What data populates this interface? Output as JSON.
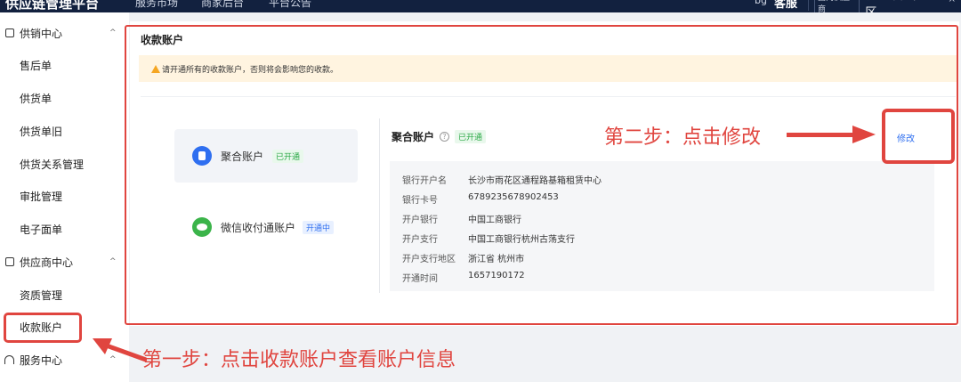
{
  "topbar": {
    "brand": "供应链管理平台",
    "nav": [
      "服务市场",
      "商家后台",
      "平台公告"
    ],
    "cs_icon": "bg",
    "customer_service": "客服",
    "region_tag": "国内供应商",
    "region": "长沙市雨花区...",
    "region_chevron": "^"
  },
  "sidebar": {
    "group1": {
      "label": "供销中心",
      "chevron": "^"
    },
    "items1": [
      "售后单",
      "供货单",
      "供货单旧",
      "供货关系管理",
      "审批管理",
      "电子面单"
    ],
    "group2": {
      "label": "供应商中心",
      "chevron": "^"
    },
    "items2": [
      "资质管理",
      "收款账户"
    ],
    "group3": {
      "label": "服务中心",
      "chevron": "^"
    }
  },
  "page": {
    "title": "收款账户",
    "alert": "请开通所有的收款账户，否则将会影响您的收款。"
  },
  "accounts": [
    {
      "name": "聚合账户",
      "status": "已开通"
    },
    {
      "name": "微信收付通账户",
      "status": "开通中"
    }
  ],
  "detail": {
    "title": "聚合账户",
    "help": "?",
    "status": "已开通",
    "edit": "修改",
    "rows": [
      {
        "key": "银行开户名",
        "value": "长沙市雨花区通程路基箱租赁中心"
      },
      {
        "key": "银行卡号",
        "value": "6789235678902453"
      },
      {
        "key": "开户银行",
        "value": "中国工商银行"
      },
      {
        "key": "开户支行",
        "value": "中国工商银行杭州古荡支行"
      },
      {
        "key": "开户支行地区",
        "value": "浙江省 杭州市"
      },
      {
        "key": "开通时间",
        "value": "1657190172"
      }
    ]
  },
  "annotations": {
    "step1": "第一步：点击收款账户查看账户信息",
    "step2": "第二步：点击修改",
    "color": "#e0453f"
  },
  "colors": {
    "accent": "#2f6ff0",
    "success": "#2aa845",
    "warning": "#f5a623",
    "topbar": "#12213f"
  }
}
